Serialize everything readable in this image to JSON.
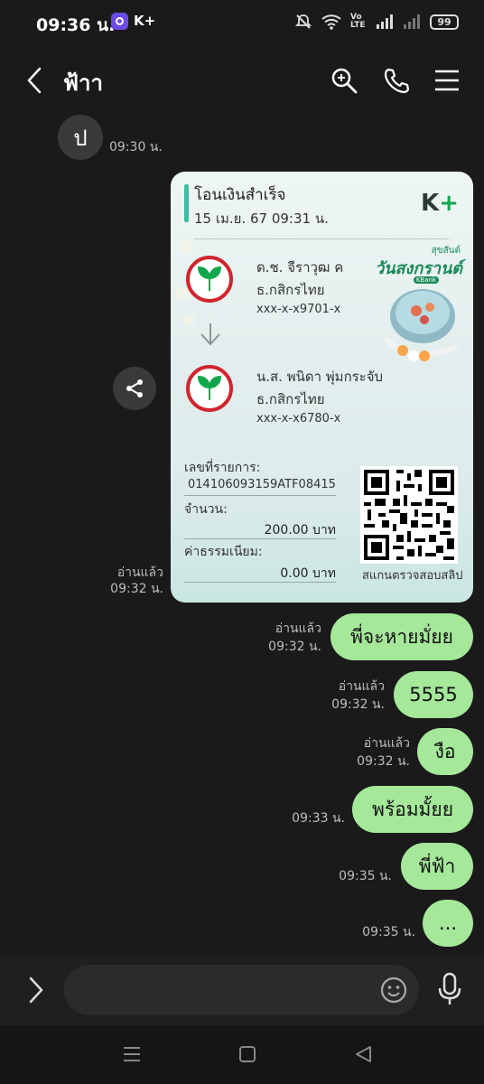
{
  "status": {
    "time": "09:36 น.",
    "app": "K+",
    "battery": "99",
    "net_label": "Vo LTE"
  },
  "header": {
    "title": "ฟ้าา"
  },
  "contact": {
    "initial": "ป"
  },
  "first_time": "09:30 น.",
  "receipt": {
    "title": "โอนเงินสำเร็จ",
    "datetime": "15 เม.ย. 67  09:31 น.",
    "brand": "K",
    "brand_plus": "+",
    "from": {
      "name": "ด.ช. จีราวุฒ ค",
      "bank": "ธ.กสิกรไทย",
      "account": "xxx-x-x9701-x"
    },
    "to": {
      "name": "น.ส. พนิดา พุ่มกระจับ",
      "bank": "ธ.กสิกรไทย",
      "account": "xxx-x-x6780-x"
    },
    "ref_label": "เลขที่รายการ:",
    "ref_value": "014106093159ATF08415",
    "amount_label": "จำนวน:",
    "amount_value": "200.00 บาท",
    "fee_label": "ค่าธรรมเนียม:",
    "fee_value": "0.00 บาท",
    "qr_caption": "สแกนตรวจสอบสลิป",
    "promo_line1": "สุขสันต์",
    "promo_line2": "วันสงกรานต์",
    "promo_tag": "KBank"
  },
  "receipt_status": {
    "read": "อ่านแล้ว",
    "time": "09:32 น."
  },
  "messages": [
    {
      "text": "พี่จะหายมั่ยย",
      "read": "อ่านแล้ว",
      "time": "09:32 น."
    },
    {
      "text": "5555",
      "read": "อ่านแล้ว",
      "time": "09:32 น."
    },
    {
      "text": "งือ",
      "read": "อ่านแล้ว",
      "time": "09:32 น."
    },
    {
      "text": "พร้อมมั้ยย",
      "read": "",
      "time": "09:33 น."
    },
    {
      "text": "พี่ฟ้า",
      "read": "",
      "time": "09:35 น."
    },
    {
      "text": "...",
      "read": "",
      "time": "09:35 น."
    }
  ],
  "composer": {
    "placeholder": ""
  },
  "colors": {
    "bubble": "#a5e89a",
    "background": "#1a1a1a",
    "kbank_red": "#d0262d",
    "kbank_green": "#11a64c"
  }
}
